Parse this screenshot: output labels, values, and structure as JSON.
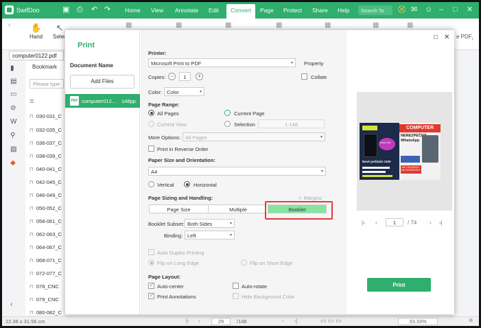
{
  "app": {
    "name": "SwifDoo",
    "menus": [
      "Home",
      "View",
      "Annotate",
      "Edit",
      "Convert",
      "Page",
      "Protect",
      "Share",
      "Help"
    ],
    "active_menu": "Convert",
    "search_placeholder": "Search To"
  },
  "ribbon": {
    "hand": "Hand",
    "select": "Selec",
    "right_text": "e PDF"
  },
  "file_tab": "computer0122.pdf",
  "bookmark": {
    "title": "Bookmark",
    "search_placeholder": "Please type",
    "items": [
      "030-031_C",
      "032-035_C",
      "036-037_C",
      "038-039_C",
      "040-041_C",
      "042-045_C",
      "046-049_C",
      "050-052_C",
      "058-061_C",
      "062-063_C",
      "064-067_C",
      "068-071_C",
      "072-077_C",
      "078_CNC",
      "079_CNC",
      "080-082_C"
    ]
  },
  "status": {
    "size": "22.36 x 31.56 cm",
    "page_current": "29",
    "page_total": "/148",
    "zoom": "33.33%"
  },
  "dialog": {
    "title": "Print",
    "document_name_label": "Document Name",
    "add_files": "Add Files",
    "doc_filename": "computer012...",
    "doc_pages": "148pp.",
    "printer_label": "Printer:",
    "printer_value": "Microsoft Print to PDF",
    "property": "Property",
    "copies_label": "Copies:",
    "copies_value": "1",
    "collate": "Collate",
    "color_label": "Color:",
    "color_value": "Color",
    "page_range_label": "Page Range:",
    "all_pages": "All Pages",
    "current_page": "Current Page",
    "current_view": "Current View",
    "selection": "Selection",
    "range_value": "1-148",
    "more_options_label": "More Options:",
    "more_options_value": "All Pages",
    "print_reverse": "Print in Reverse Order",
    "paper_label": "Paper Size and Orientation:",
    "paper_value": "A4",
    "vertical": "Vertical",
    "horizontal": "Horizontal",
    "sizing_label": "Page Sizing and Handling:",
    "margins": "Margins",
    "page_size": "Page Size",
    "multiple": "Multiple",
    "booklet": "Booklet",
    "booklet_subset_label": "Booklet Subset:",
    "booklet_subset_value": "Both Sides",
    "binding_label": "Binding:",
    "binding_value": "Left",
    "auto_duplex": "Auto Duplex Printing",
    "flip_long": "Flip on Long Edge",
    "flip_short": "Flip on Short Edge",
    "page_layout_label": "Page Layout:",
    "auto_center": "Auto-center",
    "auto_rotate": "Auto-rotate",
    "print_annotations": "Print Annotations",
    "hide_background": "Hide Background Color",
    "preview_page": "1",
    "preview_total": "/ 74",
    "print_button": "Print"
  },
  "preview": {
    "mag1_headline": "Nové počítače 1100",
    "mag1_tag": "svou hru",
    "mag2_masthead": "COMPUTER",
    "mag2_headline": "NEREZPEČNÝ WhatsApp",
    "mag2_red": "JAK PRODÁVAT NA FACEBOOKU"
  },
  "colors": {
    "brand": "#2fae6d",
    "highlight": "#86e4a0",
    "annotation": "#e23b3b"
  }
}
